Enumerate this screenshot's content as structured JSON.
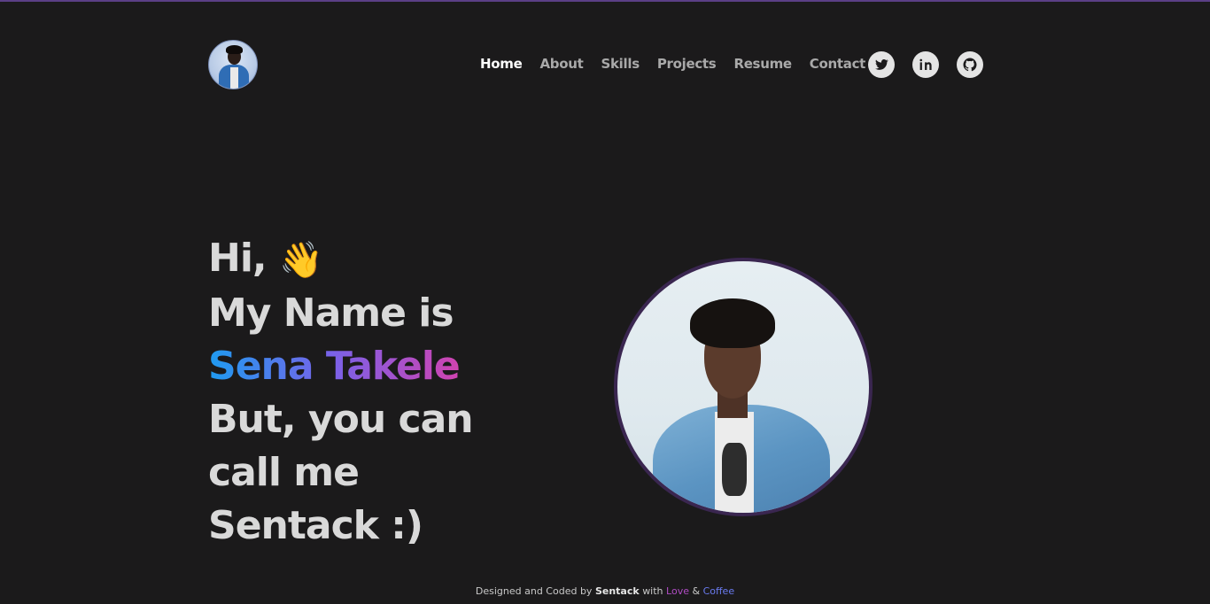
{
  "header": {
    "nav": [
      {
        "label": "Home",
        "active": true
      },
      {
        "label": "About",
        "active": false
      },
      {
        "label": "Skills",
        "active": false
      },
      {
        "label": "Projects",
        "active": false
      },
      {
        "label": "Resume",
        "active": false
      },
      {
        "label": "Contact",
        "active": false
      }
    ],
    "socials": [
      "twitter-icon",
      "linkedin-icon",
      "github-icon"
    ]
  },
  "hero": {
    "greeting": "Hi,",
    "wave_emoji": "👋",
    "line2": "My Name is",
    "name": "Sena Takele",
    "line4": "But, you can",
    "line5": "call me",
    "line6": "Sentack :)"
  },
  "footer": {
    "prefix": "Designed and Coded by",
    "brand": "Sentack",
    "with": "with",
    "love": "Love",
    "amp": "&",
    "coffee": "Coffee"
  },
  "colors": {
    "background": "#1b1a1b",
    "accent_blue": "#1e9bf0",
    "accent_purple": "#7b61e8",
    "accent_pink": "#d043b0"
  }
}
